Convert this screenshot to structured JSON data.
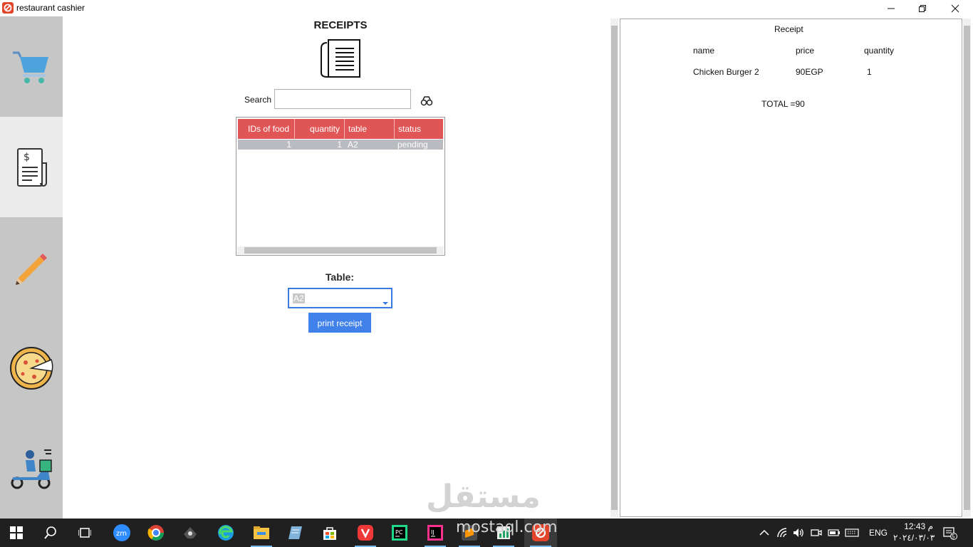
{
  "window": {
    "title": "restaurant cashier",
    "controls": [
      "minimize-icon",
      "restore-icon",
      "close-icon"
    ]
  },
  "sidebar": {
    "items": [
      {
        "name": "cart",
        "icon": "shopping-cart-icon",
        "active": false
      },
      {
        "name": "receipts",
        "icon": "receipt-icon",
        "active": true
      },
      {
        "name": "edit",
        "icon": "pencil-icon",
        "active": false
      },
      {
        "name": "food",
        "icon": "pizza-icon",
        "active": false
      },
      {
        "name": "delivery",
        "icon": "delivery-scooter-icon",
        "active": false
      }
    ]
  },
  "main": {
    "title": "RECEIPTS",
    "header_icon": "receipts-document-icon",
    "search": {
      "label": "Search",
      "value": "",
      "icon": "search-binoculars-icon"
    },
    "orders_table": {
      "columns": [
        "IDs of food",
        "quantity",
        "table",
        "status"
      ],
      "rows": [
        {
          "ids": "1",
          "quantity": "1",
          "table": "A2",
          "status": "pending"
        }
      ]
    },
    "table_label": "Table:",
    "table_select": {
      "value": "A2"
    },
    "print_button": "print receipt"
  },
  "receipt": {
    "title": "Receipt",
    "headers": {
      "name": "name",
      "price": "price",
      "quantity": "quantity"
    },
    "items": [
      {
        "name": "Chicken Burger 2",
        "price": "90EGP",
        "quantity": "1"
      }
    ],
    "total": "TOTAL =90"
  },
  "watermark": {
    "text": "مستقل",
    "sub": "mostaql.com"
  },
  "taskbar": {
    "apps": [
      "windows-start-icon",
      "search-icon",
      "task-view-icon",
      "zoom-icon",
      "chrome-icon",
      "inkscape-icon",
      "edge-icon",
      "file-explorer-icon",
      "notepad-icon",
      "store-icon",
      "vivaldi-icon",
      "pycharm-icon",
      "intellij-icon",
      "sublime-icon",
      "excel-icon",
      "restaurant-cashier-icon"
    ],
    "language": "ENG",
    "time": "12:43 م",
    "date": "٢٠٢٤/٠٣/٠٣",
    "notification_count": "5"
  },
  "colors": {
    "table_header": "#e05656",
    "selected_row": "#b9bbc0",
    "accent": "#4182ea",
    "sidebar": "#c6c6c6",
    "taskbar": "#202020"
  }
}
